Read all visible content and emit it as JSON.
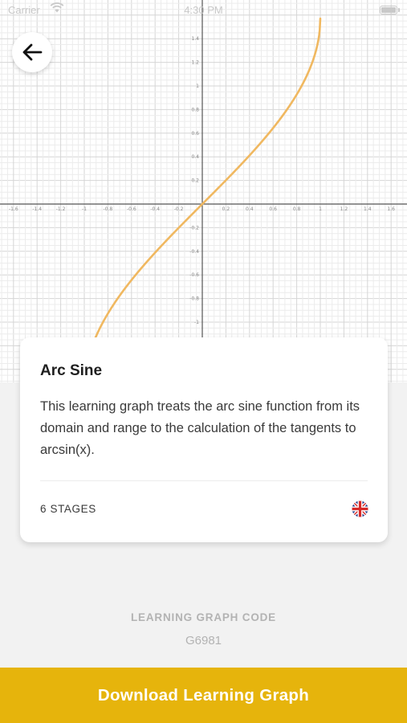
{
  "status_bar": {
    "carrier": "Carrier",
    "time": "4:30 PM"
  },
  "back_button": {
    "icon": "arrow-left-icon"
  },
  "chart_data": {
    "type": "line",
    "function": "arcsin(x)",
    "x_range": [
      -1.7,
      1.7
    ],
    "y_range": [
      -1.3,
      1.55
    ],
    "x_ticks": [
      -1.6,
      -1.4,
      -1.2,
      -1,
      -0.8,
      -0.6,
      -0.4,
      -0.2,
      0.2,
      0.4,
      0.6,
      0.8,
      1,
      1.2,
      1.4,
      1.6
    ],
    "x_tick_labels": [
      "-1.6",
      "-1.4",
      "-1.2",
      "-1",
      "-0.8",
      "-0.6",
      "-0.4",
      "-0.2",
      "0.2",
      "0.4",
      "0.6",
      "0.8",
      "1",
      "1.2",
      "1.4",
      "1.6"
    ],
    "y_ticks": [
      1.4,
      1.2,
      1,
      0.8,
      0.6,
      0.4,
      0.2,
      -0.2,
      -0.4,
      -0.6,
      -0.8,
      -1
    ],
    "y_tick_labels": [
      "1.4",
      "1.2",
      "1",
      "0.8",
      "0.6",
      "0.4",
      "0.2",
      "-0.2",
      "-0.4",
      "-0.6",
      "-0.8",
      "-1"
    ],
    "grid": true,
    "line_color": "#f0b860"
  },
  "card": {
    "title": "Arc Sine",
    "description": "This learning graph treats the arc sine function from its domain and range to the calculation of the tangents to arcsin(x).",
    "stages_label": "6 STAGES",
    "language_icon": "uk-flag-icon"
  },
  "code_section": {
    "label": "LEARNING GRAPH CODE",
    "value": "G6981"
  },
  "download_button": {
    "label": "Download Learning Graph",
    "color": "#e6b40c"
  }
}
